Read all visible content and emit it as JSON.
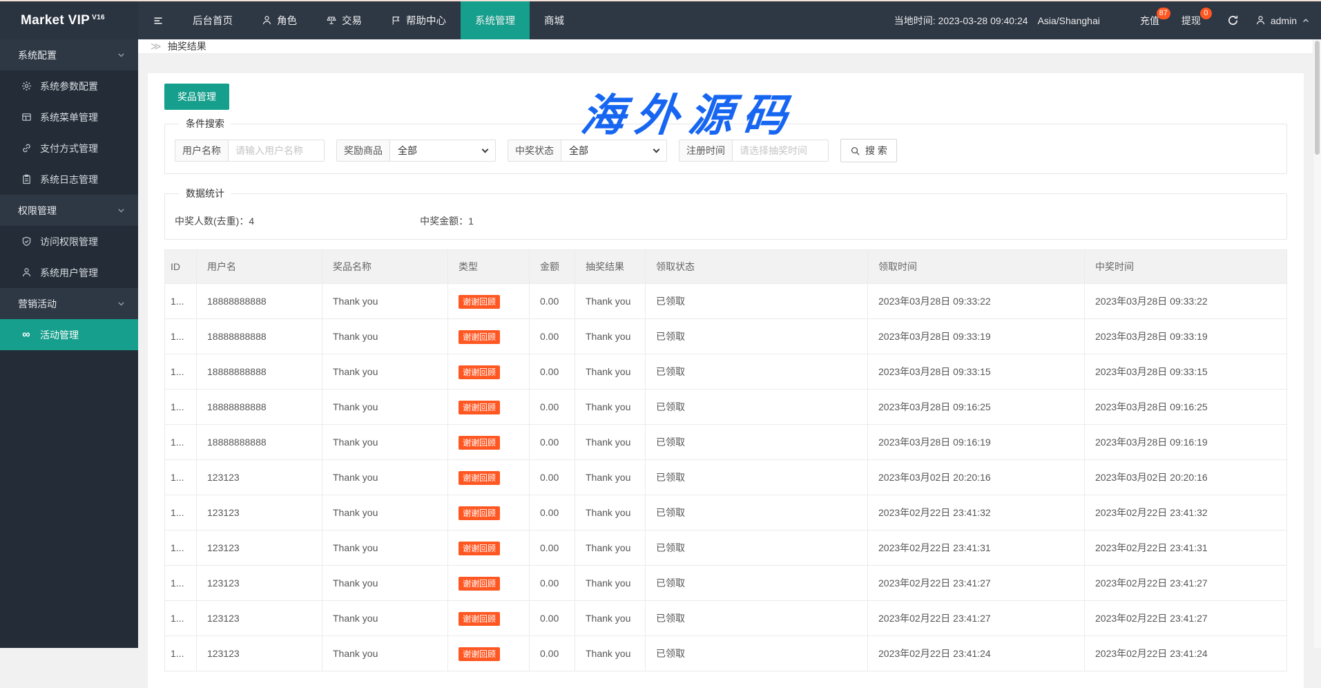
{
  "app": {
    "title": "Market VIP",
    "version": "V16"
  },
  "header": {
    "nav": [
      {
        "name": "menu-toggle",
        "icon": "hamburger",
        "label": ""
      },
      {
        "name": "home",
        "label": "后台首页"
      },
      {
        "name": "roles",
        "icon": "user",
        "label": "角色"
      },
      {
        "name": "trade",
        "icon": "scales",
        "label": "交易"
      },
      {
        "name": "help-center",
        "icon": "flag",
        "label": "帮助中心"
      },
      {
        "name": "system-management",
        "label": "系统管理",
        "active": true
      },
      {
        "name": "mall",
        "label": "商城"
      }
    ],
    "local_time": "当地时间: 2023-03-28 09:40:24",
    "timezone": "Asia/Shanghai",
    "recharge": {
      "label": "充值",
      "badge": "87"
    },
    "withdraw": {
      "label": "提现",
      "badge": "0"
    },
    "username": "admin"
  },
  "sidebar": {
    "groups": [
      {
        "name": "system-config",
        "label": "系统配置",
        "items": [
          {
            "name": "system-params",
            "icon": "gear",
            "label": "系统参数配置"
          },
          {
            "name": "system-menu",
            "icon": "grid",
            "label": "系统菜单管理"
          },
          {
            "name": "payment-methods",
            "icon": "link",
            "label": "支付方式管理"
          },
          {
            "name": "system-logs",
            "icon": "clipboard",
            "label": "系统日志管理"
          }
        ]
      },
      {
        "name": "permissions",
        "label": "权限管理",
        "items": [
          {
            "name": "access-permissions",
            "icon": "shield",
            "label": "访问权限管理"
          },
          {
            "name": "system-users",
            "icon": "person",
            "label": "系统用户管理"
          }
        ]
      },
      {
        "name": "marketing",
        "label": "营销活动",
        "items": [
          {
            "name": "activity-management",
            "icon": "infinity",
            "label": "活动管理",
            "active": true
          }
        ]
      }
    ]
  },
  "breadcrumb": {
    "icon": "≫",
    "label": "抽奖结果"
  },
  "main": {
    "prize_button": "奖品管理",
    "search": {
      "legend": "条件搜索",
      "username_label": "用户名称",
      "username_placeholder": "请输入用户名称",
      "prize_label": "奖励商品",
      "prize_value": "全部",
      "status_label": "中奖状态",
      "status_value": "全部",
      "time_label": "注册时间",
      "time_placeholder": "请选择抽奖时间",
      "search_button": "搜 索"
    },
    "stats": {
      "legend": "数据统计",
      "winners_label": "中奖人数(去重)：",
      "winners_value": "4",
      "amount_label": "中奖金额：",
      "amount_value": "1"
    },
    "table": {
      "headers": [
        "ID",
        "用户名",
        "奖品名称",
        "类型",
        "金额",
        "抽奖结果",
        "领取状态",
        "领取时间",
        "中奖时间"
      ],
      "rows": [
        {
          "id": "1...",
          "username": "18888888888",
          "prize": "Thank you",
          "type": "谢谢回顾",
          "amount": "0.00",
          "result": "Thank you",
          "claim_status": "已领取",
          "claim_time": "2023年03月28日 09:33:22",
          "win_time": "2023年03月28日 09:33:22"
        },
        {
          "id": "1...",
          "username": "18888888888",
          "prize": "Thank you",
          "type": "谢谢回顾",
          "amount": "0.00",
          "result": "Thank you",
          "claim_status": "已领取",
          "claim_time": "2023年03月28日 09:33:19",
          "win_time": "2023年03月28日 09:33:19"
        },
        {
          "id": "1...",
          "username": "18888888888",
          "prize": "Thank you",
          "type": "谢谢回顾",
          "amount": "0.00",
          "result": "Thank you",
          "claim_status": "已领取",
          "claim_time": "2023年03月28日 09:33:15",
          "win_time": "2023年03月28日 09:33:15"
        },
        {
          "id": "1...",
          "username": "18888888888",
          "prize": "Thank you",
          "type": "谢谢回顾",
          "amount": "0.00",
          "result": "Thank you",
          "claim_status": "已领取",
          "claim_time": "2023年03月28日 09:16:25",
          "win_time": "2023年03月28日 09:16:25"
        },
        {
          "id": "1...",
          "username": "18888888888",
          "prize": "Thank you",
          "type": "谢谢回顾",
          "amount": "0.00",
          "result": "Thank you",
          "claim_status": "已领取",
          "claim_time": "2023年03月28日 09:16:19",
          "win_time": "2023年03月28日 09:16:19"
        },
        {
          "id": "1...",
          "username": "123123",
          "prize": "Thank you",
          "type": "谢谢回顾",
          "amount": "0.00",
          "result": "Thank you",
          "claim_status": "已领取",
          "claim_time": "2023年03月02日 20:20:16",
          "win_time": "2023年03月02日 20:20:16"
        },
        {
          "id": "1...",
          "username": "123123",
          "prize": "Thank you",
          "type": "谢谢回顾",
          "amount": "0.00",
          "result": "Thank you",
          "claim_status": "已领取",
          "claim_time": "2023年02月22日 23:41:32",
          "win_time": "2023年02月22日 23:41:32"
        },
        {
          "id": "1...",
          "username": "123123",
          "prize": "Thank you",
          "type": "谢谢回顾",
          "amount": "0.00",
          "result": "Thank you",
          "claim_status": "已领取",
          "claim_time": "2023年02月22日 23:41:31",
          "win_time": "2023年02月22日 23:41:31"
        },
        {
          "id": "1...",
          "username": "123123",
          "prize": "Thank you",
          "type": "谢谢回顾",
          "amount": "0.00",
          "result": "Thank you",
          "claim_status": "已领取",
          "claim_time": "2023年02月22日 23:41:27",
          "win_time": "2023年02月22日 23:41:27"
        },
        {
          "id": "1...",
          "username": "123123",
          "prize": "Thank you",
          "type": "谢谢回顾",
          "amount": "0.00",
          "result": "Thank you",
          "claim_status": "已领取",
          "claim_time": "2023年02月22日 23:41:27",
          "win_time": "2023年02月22日 23:41:27"
        },
        {
          "id": "1...",
          "username": "123123",
          "prize": "Thank you",
          "type": "谢谢回顾",
          "amount": "0.00",
          "result": "Thank you",
          "claim_status": "已领取",
          "claim_time": "2023年02月22日 23:41:24",
          "win_time": "2023年02月22日 23:41:24"
        }
      ]
    }
  },
  "watermark": "海外源码",
  "colors": {
    "accent_teal": "#169f8c",
    "badge_orange": "#ff5722",
    "notification_red": "#ff5722",
    "watermark_blue": "#1766f2"
  }
}
